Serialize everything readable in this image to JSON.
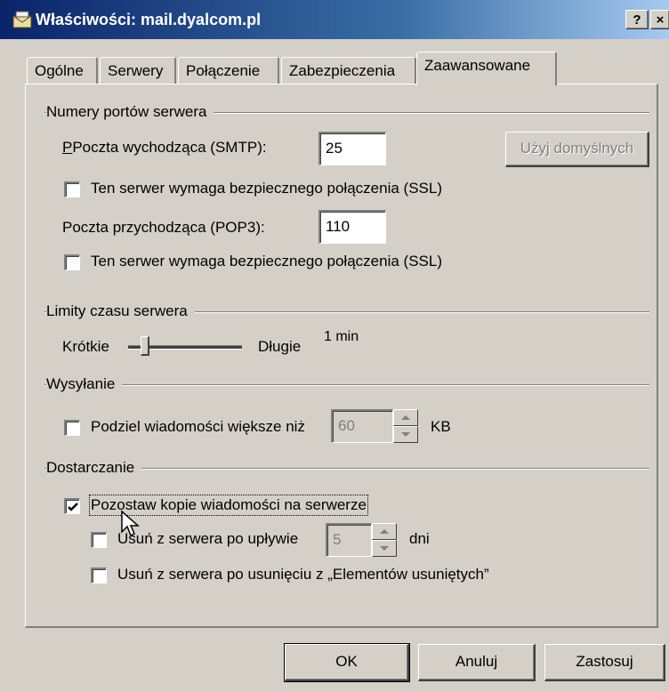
{
  "window": {
    "title": "Właściwości: mail.dyalcom.pl",
    "help_button": "?",
    "close_button": "×"
  },
  "tabs": [
    {
      "label": "Ogólne",
      "active": false
    },
    {
      "label": "Serwery",
      "active": false
    },
    {
      "label": "Połączenie",
      "active": false
    },
    {
      "label": "Zabezpieczenia",
      "active": false
    },
    {
      "label": "Zaawansowane",
      "active": true
    }
  ],
  "ports": {
    "group_label": "Numery portów serwera",
    "smtp_label": "Poczta wychodząca (SMTP):",
    "smtp_value": "25",
    "default_button": "Użyj domyślnych",
    "smtp_ssl_label": "Ten serwer wymaga bezpiecznego połączenia (SSL)",
    "smtp_ssl_checked": false,
    "pop3_label": "Poczta przychodząca (POP3):",
    "pop3_value": "110",
    "pop3_ssl_label": "Ten serwer wymaga bezpiecznego połączenia (SSL)",
    "pop3_ssl_checked": false
  },
  "timeouts": {
    "group_label": "Limity czasu serwera",
    "short_label": "Krótkie",
    "long_label": "Długie",
    "value_text": "1 min",
    "slider_fraction": 0.12
  },
  "sending": {
    "group_label": "Wysyłanie",
    "split_label": "Podziel wiadomości większe niż",
    "split_checked": false,
    "split_value": "60",
    "unit": "KB"
  },
  "delivery": {
    "group_label": "Dostarczanie",
    "leave_copy_label": "Pozostaw kopie wiadomości na serwerze",
    "leave_copy_checked": true,
    "remove_after_label": "Usuń z serwera po upływie",
    "remove_after_checked": false,
    "remove_after_value": "5",
    "days_unit": "dni",
    "remove_deleted_label": "Usuń z serwera po usunięciu z „Elementów usuniętych”",
    "remove_deleted_checked": false
  },
  "buttons": {
    "ok": "OK",
    "cancel": "Anuluj",
    "apply": "Zastosuj"
  },
  "icons": {
    "window_icon": "mail-server-icon",
    "cursor": "arrow-cursor-icon"
  }
}
